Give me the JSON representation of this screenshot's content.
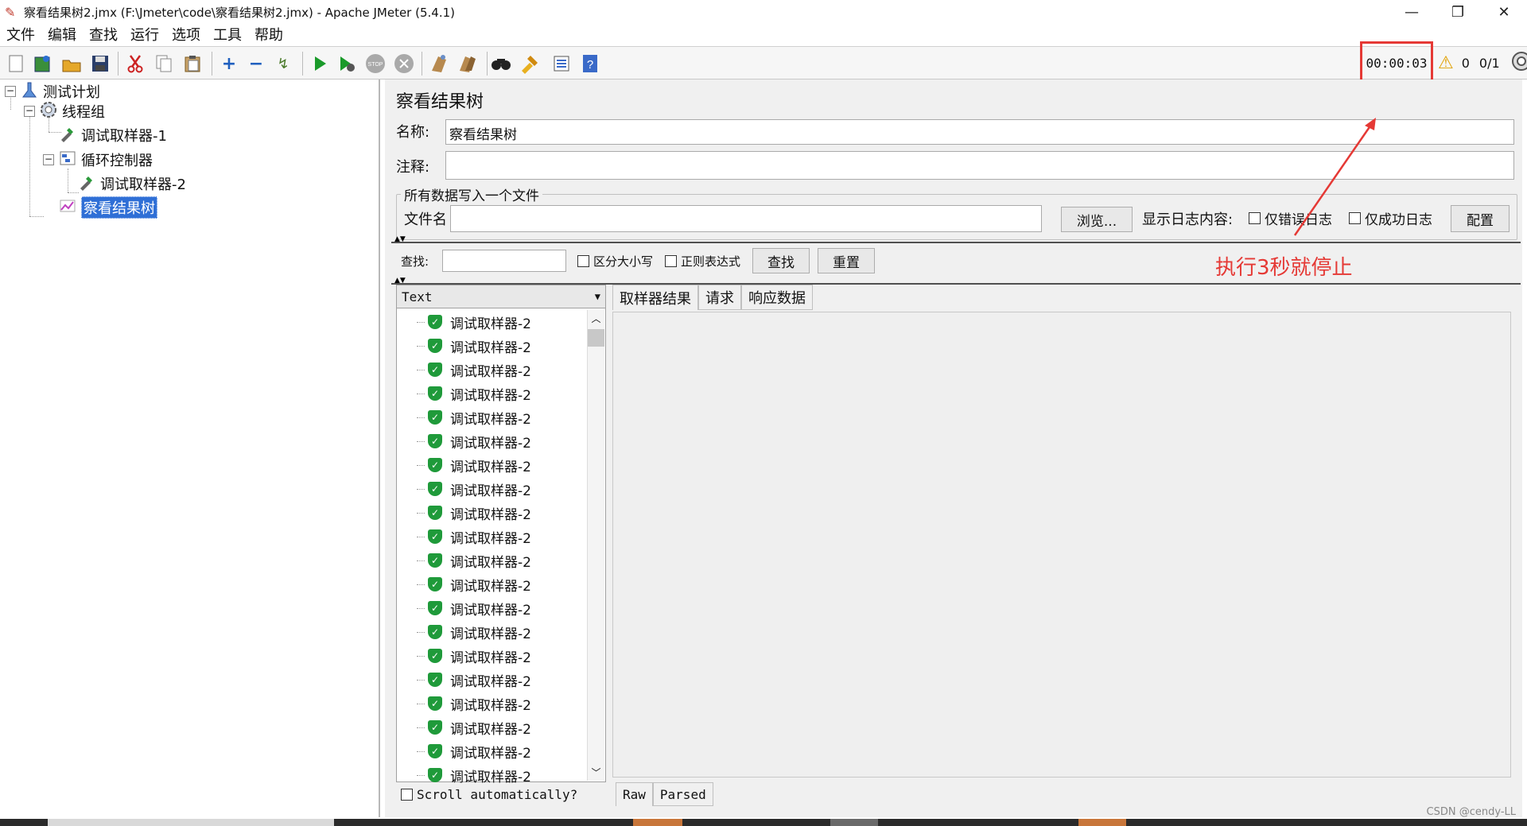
{
  "window": {
    "title": "察看结果树2.jmx (F:\\Jmeter\\code\\察看结果树2.jmx) - Apache JMeter (5.4.1)",
    "minimize": "—",
    "maximize": "❐",
    "close": "✕"
  },
  "menu": [
    "文件",
    "编辑",
    "查找",
    "运行",
    "选项",
    "工具",
    "帮助"
  ],
  "toolbar": {
    "icons": [
      "new-icon",
      "templates-icon",
      "open-icon",
      "save-icon",
      "cut-icon",
      "copy-icon",
      "paste-icon",
      "expand-icon",
      "collapse-icon",
      "toggle-icon",
      "start-icon",
      "start-no-pause-icon",
      "stop-icon",
      "shutdown-icon",
      "clear-icon",
      "clear-all-icon",
      "search-icon",
      "reset-search-icon",
      "function-helper-icon",
      "help-icon"
    ],
    "timer": "00:00:03",
    "warnings": "0",
    "threads": "0/1"
  },
  "tree": {
    "nodes": [
      {
        "label": "测试计划",
        "icon": "test-plan-icon"
      },
      {
        "label": "线程组",
        "icon": "thread-group-icon"
      },
      {
        "label": "调试取样器-1",
        "icon": "sampler-icon"
      },
      {
        "label": "循环控制器",
        "icon": "loop-controller-icon"
      },
      {
        "label": "调试取样器-2",
        "icon": "sampler-icon"
      },
      {
        "label": "察看结果树",
        "icon": "listener-icon"
      }
    ]
  },
  "panel": {
    "title": "察看结果树",
    "name_label": "名称:",
    "name_value": "察看结果树",
    "comment_label": "注释:",
    "comment_value": "",
    "file_group_title": "所有数据写入一个文件",
    "filename_label": "文件名",
    "filename_value": "",
    "browse_button": "浏览...",
    "log_display_label": "显示日志内容:",
    "errors_only": "仅错误日志",
    "success_only": "仅成功日志",
    "configure_button": "配置"
  },
  "search": {
    "label": "查找:",
    "value": "",
    "case_sensitive": "区分大小写",
    "regex": "正则表达式",
    "find_button": "查找",
    "reset_button": "重置"
  },
  "annotation": {
    "text": "执行3秒就停止",
    "color": "#e53935"
  },
  "results": {
    "renderer": "Text",
    "items": [
      "调试取样器-2",
      "调试取样器-2",
      "调试取样器-2",
      "调试取样器-2",
      "调试取样器-2",
      "调试取样器-2",
      "调试取样器-2",
      "调试取样器-2",
      "调试取样器-2",
      "调试取样器-2",
      "调试取样器-2",
      "调试取样器-2",
      "调试取样器-2",
      "调试取样器-2",
      "调试取样器-2",
      "调试取样器-2",
      "调试取样器-2",
      "调试取样器-2",
      "调试取样器-2",
      "调试取样器-2"
    ],
    "scroll_auto": "Scroll automatically?",
    "status_color": "#1f9a3a"
  },
  "detail": {
    "tabs": [
      "取样器结果",
      "请求",
      "响应数据"
    ],
    "bottom_tabs": [
      "Raw",
      "Parsed"
    ]
  },
  "watermark": "CSDN @cendy-LL"
}
